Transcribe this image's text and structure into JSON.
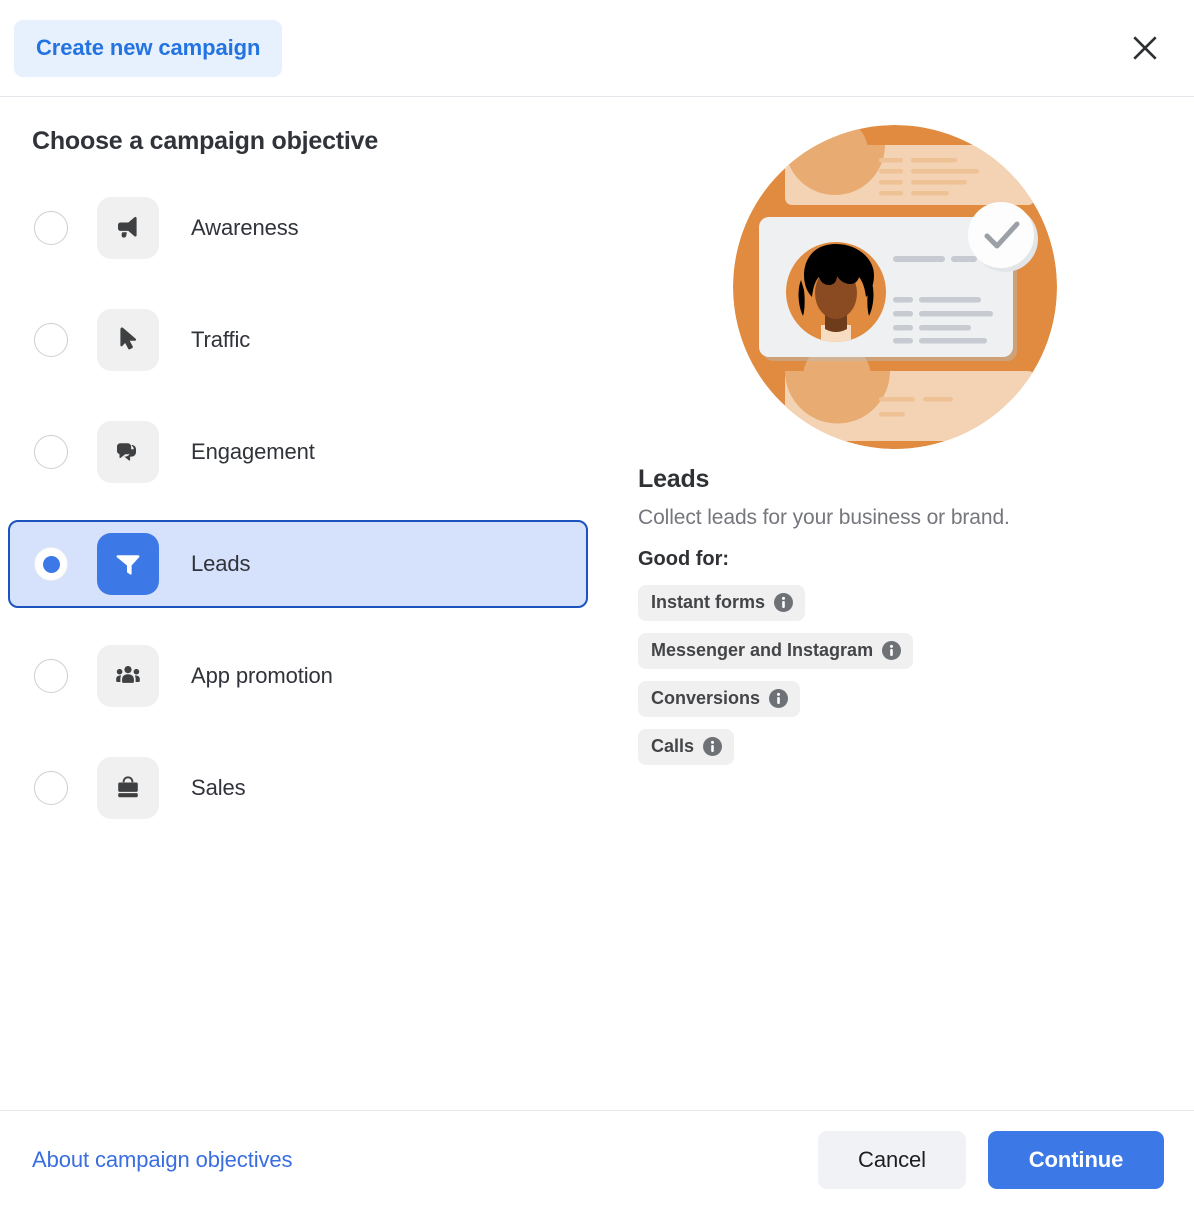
{
  "header": {
    "tab_label": "Create new campaign",
    "close_icon": "close-icon"
  },
  "main": {
    "section_title": "Choose a campaign objective",
    "objectives": [
      {
        "label": "Awareness",
        "icon": "megaphone-icon",
        "selected": false
      },
      {
        "label": "Traffic",
        "icon": "cursor-icon",
        "selected": false
      },
      {
        "label": "Engagement",
        "icon": "chat-bubbles-icon",
        "selected": false
      },
      {
        "label": "Leads",
        "icon": "funnel-icon",
        "selected": true
      },
      {
        "label": "App promotion",
        "icon": "people-group-icon",
        "selected": false
      },
      {
        "label": "Sales",
        "icon": "briefcase-icon",
        "selected": false
      }
    ]
  },
  "detail": {
    "illustration": "lead-form-illustration",
    "title": "Leads",
    "description": "Collect leads for your business or brand.",
    "good_for_label": "Good for:",
    "good_for": [
      {
        "label": "Instant forms",
        "info_icon": "info-icon"
      },
      {
        "label": "Messenger and Instagram",
        "info_icon": "info-icon"
      },
      {
        "label": "Conversions",
        "info_icon": "info-icon"
      },
      {
        "label": "Calls",
        "info_icon": "info-icon"
      }
    ]
  },
  "footer": {
    "link_label": "About campaign objectives",
    "cancel_label": "Cancel",
    "continue_label": "Continue"
  },
  "colors": {
    "accent_blue": "#3c79e6",
    "selected_row_bg": "#d6e2fb",
    "selected_row_border": "#1b53bf",
    "tab_pill_bg": "#e7f0fd",
    "tab_pill_text": "#2374e1",
    "tile_bg": "#f0f0f0",
    "icon_dark": "#3e4042",
    "pill_bg": "#f0f0f0",
    "info_grey": "#6e7176",
    "link_blue": "#3a6ee0",
    "illustration_orange": "#e08b3f",
    "illustration_peach": "#f3d3b3",
    "illustration_card": "#eef0f2",
    "illustration_hair": "#000000",
    "illustration_skin": "#8a4b22"
  }
}
